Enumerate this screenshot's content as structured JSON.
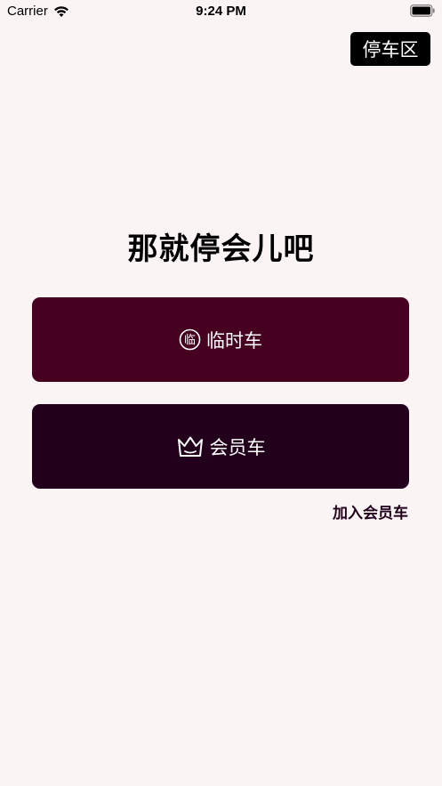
{
  "status_bar": {
    "carrier": "Carrier",
    "time": "9:24 PM"
  },
  "header": {
    "parking_label": "停车区"
  },
  "main": {
    "headline": "那就停会儿吧",
    "temp_car": {
      "label": "临时车",
      "icon_glyph": "临",
      "icon": "temporary-badge-icon",
      "color": "#460020"
    },
    "member_car": {
      "label": "会员车",
      "icon": "crown-icon",
      "color": "#22001c"
    },
    "join_member": "加入会员车"
  }
}
